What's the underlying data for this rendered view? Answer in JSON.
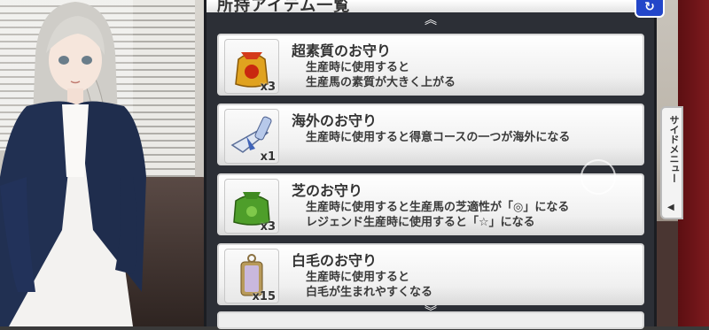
{
  "panel": {
    "title": "所持アイテム一覧",
    "close_icon": "refresh-icon"
  },
  "items": [
    {
      "name": "超素質のお守り",
      "icon": "gold-charm-bag-icon",
      "quantity": "x3",
      "desc": [
        "生産時に使用すると",
        "生産馬の素質が大きく上がる"
      ]
    },
    {
      "name": "海外のお守り",
      "icon": "airplane-charm-icon",
      "quantity": "x1",
      "desc": [
        "生産時に使用すると得意コースの一つが海外になる"
      ]
    },
    {
      "name": "芝のお守り",
      "icon": "grass-charm-bag-icon",
      "quantity": "x3",
      "desc": [
        "生産時に使用すると生産馬の芝適性が「◎」になる",
        "レジェンド生産時に使用すると「☆」になる"
      ]
    },
    {
      "name": "白毛のお守り",
      "icon": "white-coat-charm-icon",
      "quantity": "x15",
      "desc": [
        "生産時に使用すると",
        "白毛が生まれやすくなる"
      ]
    }
  ],
  "side_menu": {
    "label": "サイドメニュー",
    "arrow": "◀"
  },
  "colors": {
    "panel_bg": "#2c2f36",
    "close_button": "#2346c9",
    "item_bg": "#f0f0f0"
  }
}
